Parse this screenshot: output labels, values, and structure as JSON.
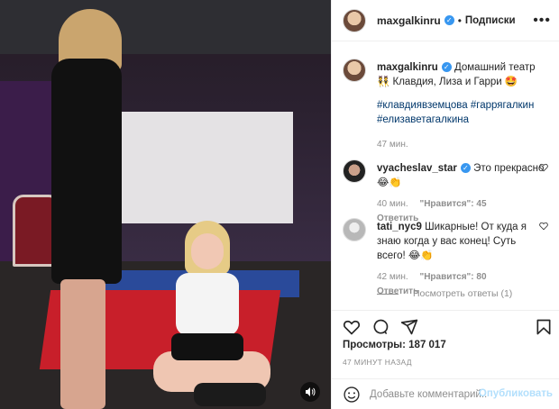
{
  "post": {
    "username": "maxgalkinru",
    "follow_separator": "•",
    "follow_label": "Подписки",
    "more_glyph": "•••"
  },
  "caption": {
    "username": "maxgalkinru",
    "text": "Домашний театр 👯 Клавдия, Лиза и Гарри 🤩",
    "hashtags": "#клавдиявземцова #гаррягалкин #елизаветагалкина",
    "time": "47 мин."
  },
  "comments": [
    {
      "username": "vyacheslav_star",
      "text": "Это прекрасно 😂👏",
      "time": "40 мин.",
      "likes": "\"Нравится\": 45",
      "reply": "Ответить"
    },
    {
      "username": "tati_nyc9",
      "text": "Шикарные! От куда я знаю когда у вас конец! Суть всего! 😂👏",
      "time": "42 мин.",
      "likes": "\"Нравится\": 80",
      "reply": "Ответить"
    }
  ],
  "view_replies": "Посмотреть ответы (1)",
  "views": "Просмотры: 187 017",
  "timestamp": "47 МИНУТ НАЗАД",
  "add_comment": {
    "placeholder": "Добавьте комментарий...",
    "publish": "Опубликовать"
  },
  "icons": {
    "like": "heart-icon",
    "comment": "comment-icon",
    "share": "share-icon",
    "save": "bookmark-icon",
    "emoji": "emoji-icon",
    "sound": "speaker-icon"
  },
  "colors": {
    "verified": "#3897f0",
    "link": "#00376b",
    "muted": "#8e8e8e",
    "publish_disabled": "#b2dffc"
  }
}
